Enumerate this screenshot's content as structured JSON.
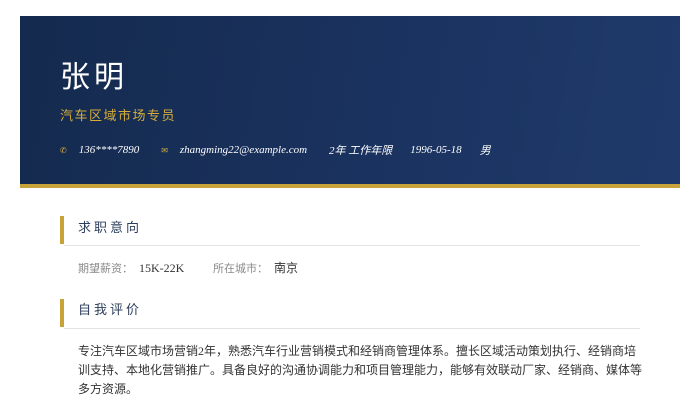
{
  "header": {
    "name": "张明",
    "job_title": "汽车区域市场专员",
    "contacts": {
      "phone_icon": "phone-icon",
      "phone": "136****7890",
      "email_icon": "mail-icon",
      "email": "zhangming22@example.com",
      "experience": "2年 工作年限",
      "birthdate": "1996-05-18",
      "gender": "男"
    }
  },
  "sections": {
    "intent": {
      "title": "求职意向",
      "salary_label": "期望薪资：",
      "salary_value": "15K-22K",
      "city_label": "所在城市：",
      "city_value": "南京"
    },
    "self_eval": {
      "title": "自我评价",
      "text": "专注汽车区域市场营销2年，熟悉汽车行业营销模式和经销商管理体系。擅长区域活动策划执行、经销商培训支持、本地化营销推广。具备良好的沟通协调能力和项目管理能力，能够有效联动厂家、经销商、媒体等多方资源。"
    }
  },
  "colors": {
    "header_bg": "#1b3361",
    "accent_gold": "#c8a33a",
    "title_gold": "#d6ad3c"
  }
}
